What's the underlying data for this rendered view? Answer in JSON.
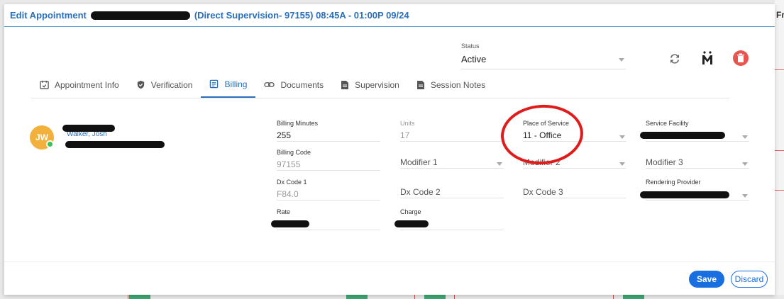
{
  "header": {
    "title_prefix": "Edit Appointment",
    "title_suffix": "(Direct Supervision- 97155) 08:45A - 01:00P 09/24"
  },
  "status": {
    "label": "Status",
    "value": "Active"
  },
  "tabs": [
    {
      "label": "Appointment Info",
      "icon": "calendar-check-icon"
    },
    {
      "label": "Verification",
      "icon": "shield-check-icon"
    },
    {
      "label": "Billing",
      "icon": "billing-icon",
      "active": true
    },
    {
      "label": "Documents",
      "icon": "link-icon"
    },
    {
      "label": "Supervision",
      "icon": "document-icon"
    },
    {
      "label": "Session Notes",
      "icon": "notes-icon"
    }
  ],
  "client": {
    "initials": "JW",
    "name": "Walker, Josh"
  },
  "fields": {
    "billing_minutes": {
      "label": "Billing Minutes",
      "value": "255"
    },
    "units": {
      "label": "Units",
      "value": "17"
    },
    "place_of_service": {
      "label": "Place of Service",
      "value": "11 - Office"
    },
    "service_facility": {
      "label": "Service Facility",
      "value": ""
    },
    "billing_code": {
      "label": "Billing Code",
      "value": "97155"
    },
    "modifier1": {
      "placeholder": "Modifier 1"
    },
    "modifier2": {
      "placeholder": "Modifier 2"
    },
    "modifier3": {
      "placeholder": "Modifier 3"
    },
    "dx_code1": {
      "label": "Dx Code 1",
      "value": "F84.0"
    },
    "dx_code2": {
      "placeholder": "Dx Code 2"
    },
    "dx_code3": {
      "placeholder": "Dx Code 3"
    },
    "rendering_provider": {
      "label": "Rendering Provider",
      "value": ""
    },
    "rate": {
      "label": "Rate",
      "value": ""
    },
    "charge": {
      "label": "Charge",
      "value": ""
    }
  },
  "buttons": {
    "save": "Save",
    "discard": "Discard"
  },
  "background": {
    "fr_text": "Fr"
  },
  "colors": {
    "accent": "#2a6fb8",
    "save_button": "#1a6fe0",
    "avatar": "#f2b13c",
    "annotation_circle": "#e01b1b",
    "delete": "#e8554e"
  }
}
